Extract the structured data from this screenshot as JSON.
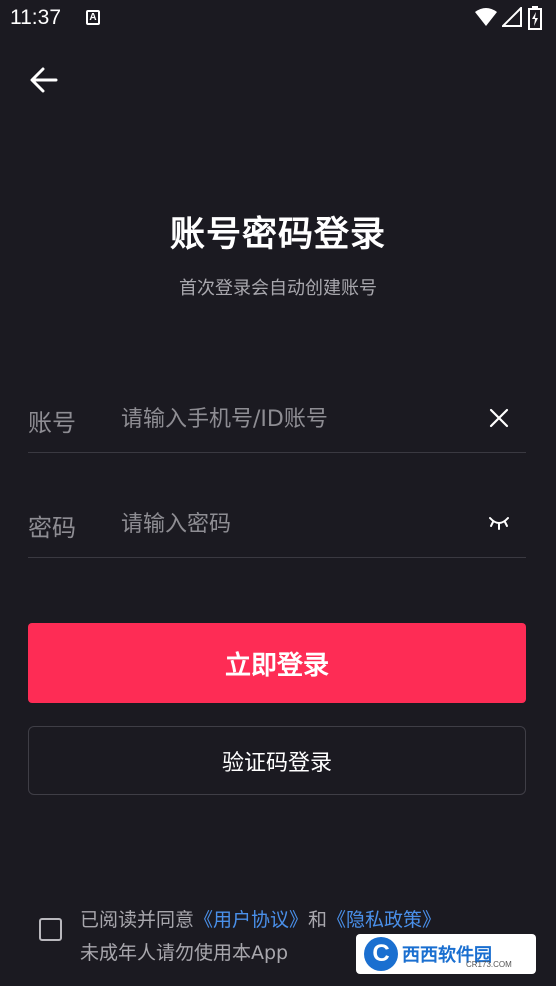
{
  "status_bar": {
    "time": "11:37",
    "a_icon_label": "A"
  },
  "header": {
    "title": "账号密码登录",
    "subtitle": "首次登录会自动创建账号"
  },
  "account_field": {
    "label": "账号",
    "placeholder": "请输入手机号/ID账号",
    "value": ""
  },
  "password_field": {
    "label": "密码",
    "placeholder": "请输入密码",
    "value": ""
  },
  "buttons": {
    "login_label": "立即登录",
    "code_login_label": "验证码登录"
  },
  "agreement": {
    "checked": false,
    "prefix": "已阅读并同意",
    "user_agreement": "《用户协议》",
    "and": "和",
    "privacy_policy": "《隐私政策》",
    "line2": "未成年人请勿使用本App"
  },
  "watermark": {
    "logo_letter": "C",
    "name": "西西软件园",
    "domain": "CR173.COM"
  },
  "colors": {
    "background": "#1b1a21",
    "accent": "#fe2c55",
    "link": "#4a90ea"
  }
}
